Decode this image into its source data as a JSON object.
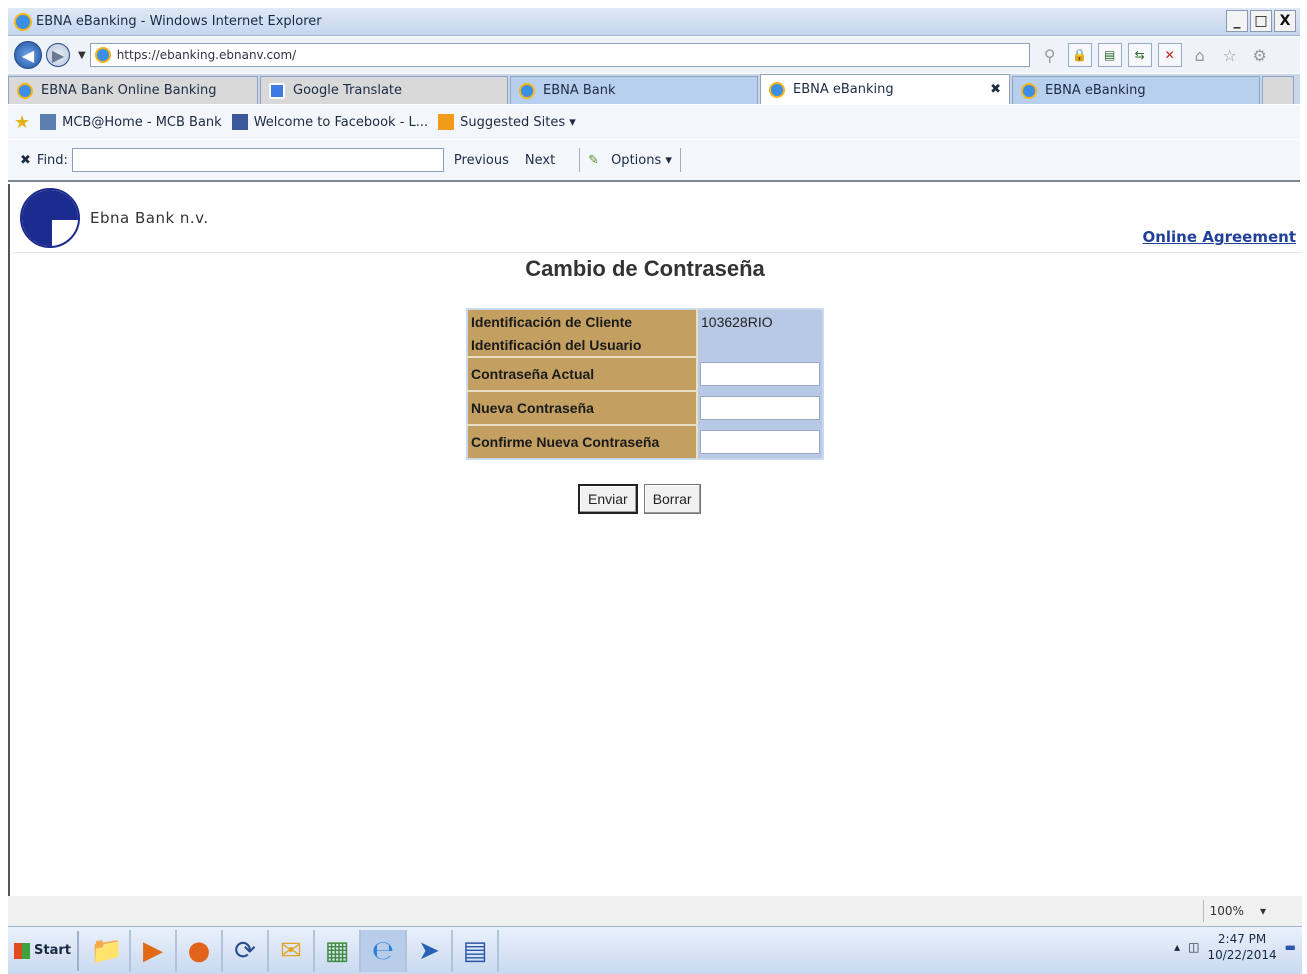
{
  "window": {
    "title": "EBNA eBanking - Windows Internet Explorer",
    "controls": [
      "_",
      "□",
      "X"
    ]
  },
  "address_bar": {
    "url": "https://ebanking.ebnanv.com/"
  },
  "tabs": [
    {
      "label": "EBNA Bank Online Banking",
      "icon": "ie-page-icon"
    },
    {
      "label": "Google Translate",
      "icon": "google-translate-icon"
    },
    {
      "label": "EBNA Bank",
      "icon": "ie-page-icon"
    },
    {
      "label": "EBNA eBanking",
      "icon": "ie-page-icon",
      "active": true
    },
    {
      "label": "EBNA eBanking",
      "icon": "ie-page-icon"
    }
  ],
  "favorites": {
    "items": [
      {
        "label": "MCB@Home - MCB Bank",
        "icon": "mcb-icon"
      },
      {
        "label": "Welcome to Facebook - L...",
        "icon": "facebook-icon"
      },
      {
        "label": "Suggested Sites ▾",
        "icon": "suggested-sites-icon"
      }
    ]
  },
  "find_bar": {
    "close": "✖",
    "label": "Find:",
    "value": "",
    "previous": "Previous",
    "next": "Next",
    "options": "Options ▾"
  },
  "page": {
    "logo_text": "Ebna Bank n.v.",
    "agreement_link": "Online Agreement",
    "heading": "Cambio de Contraseña",
    "form": {
      "client_id_label": "Identificación de Cliente",
      "client_id_value": "103628RIO",
      "user_id_label": "Identificación del Usuario",
      "user_id_value": "",
      "current_password_label": "Contraseña Actual",
      "new_password_label": "Nueva Contraseña",
      "confirm_password_label": "Confirme Nueva Contraseña"
    },
    "buttons": {
      "submit": "Enviar",
      "clear": "Borrar"
    }
  },
  "status_bar": {
    "zoom": "100%",
    "zoom_arrow": "▾"
  },
  "taskbar": {
    "start_label": "Start",
    "apps": [
      "explorer-folder-icon",
      "media-player-icon",
      "firefox-icon",
      "app-sync-icon",
      "outlook-icon",
      "network-icon",
      "internet-explorer-icon",
      "remote-desktop-icon",
      "word-icon"
    ],
    "time": "2:47 PM",
    "date": "10/22/2014"
  },
  "colors": {
    "label_bg": "#c39f62",
    "value_bg": "#b8c9e6",
    "link": "#22409a",
    "logo_blue": "#1b2b8e"
  }
}
